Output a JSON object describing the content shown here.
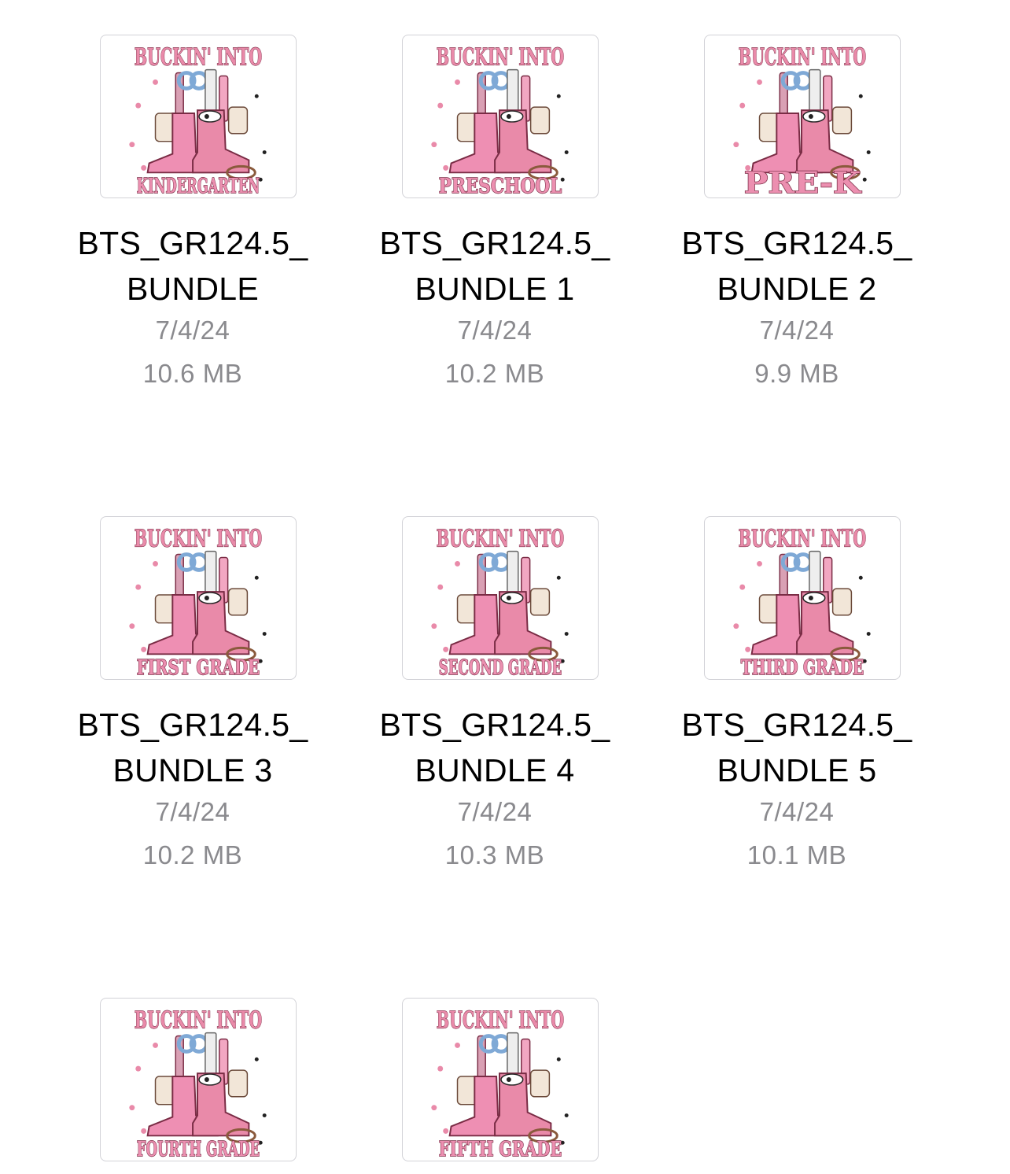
{
  "files": [
    {
      "name_line1": "BTS_GR124.5_",
      "name_line2": "BUNDLE",
      "date": "7/4/24",
      "size": "10.6 MB",
      "art_top": "BUCKIN' INTO",
      "art_bottom": "KINDERGARTEN",
      "icon": "bts-design-thumbnail-icon"
    },
    {
      "name_line1": "BTS_GR124.5_",
      "name_line2": "BUNDLE 1",
      "date": "7/4/24",
      "size": "10.2 MB",
      "art_top": "BUCKIN' INTO",
      "art_bottom": "PRESCHOOL",
      "icon": "bts-design-thumbnail-icon"
    },
    {
      "name_line1": "BTS_GR124.5_",
      "name_line2": "BUNDLE 2",
      "date": "7/4/24",
      "size": "9.9 MB",
      "art_top": "BUCKIN' INTO",
      "art_bottom": "PRE-K",
      "icon": "bts-design-thumbnail-icon"
    },
    {
      "name_line1": "BTS_GR124.5_",
      "name_line2": "BUNDLE 3",
      "date": "7/4/24",
      "size": "10.2 MB",
      "art_top": "BUCKIN' INTO",
      "art_bottom": "FIRST GRADE",
      "icon": "bts-design-thumbnail-icon"
    },
    {
      "name_line1": "BTS_GR124.5_",
      "name_line2": "BUNDLE 4",
      "date": "7/4/24",
      "size": "10.3 MB",
      "art_top": "BUCKIN' INTO",
      "art_bottom": "SECOND GRADE",
      "icon": "bts-design-thumbnail-icon"
    },
    {
      "name_line1": "BTS_GR124.5_",
      "name_line2": "BUNDLE 5",
      "date": "7/4/24",
      "size": "10.1 MB",
      "art_top": "BUCKIN' INTO",
      "art_bottom": "THIRD GRADE",
      "icon": "bts-design-thumbnail-icon"
    },
    {
      "name_line1": "",
      "name_line2": "",
      "date": "",
      "size": "",
      "art_top": "BUCKIN' INTO",
      "art_bottom": "FOURTH GRADE",
      "icon": "bts-design-thumbnail-icon"
    },
    {
      "name_line1": "",
      "name_line2": "",
      "date": "",
      "size": "",
      "art_top": "BUCKIN' INTO",
      "art_bottom": "FIFTH GRADE",
      "icon": "bts-design-thumbnail-icon"
    }
  ],
  "colors": {
    "title": "#000000",
    "meta": "#8a8a8e",
    "thumb_border": "#d2d2d7",
    "art_pink": "#e98aa9",
    "art_outline": "#7a2c45",
    "art_blue": "#7fa9d6"
  }
}
